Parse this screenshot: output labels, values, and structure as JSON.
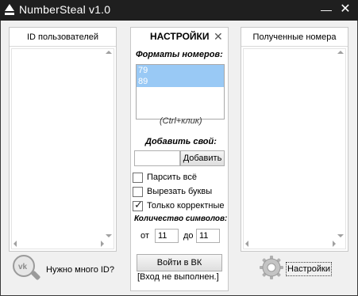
{
  "window": {
    "title": "NumberSteal v1.0",
    "minimize_glyph": "—",
    "close_glyph": "✕"
  },
  "left_panel": {
    "header": "ID пользователей",
    "footer_text": "Нужно много ID?"
  },
  "settings": {
    "title": "НАСТРОЙКИ",
    "close_glyph": "✕",
    "formats_label": "Форматы номеров:",
    "formats": [
      "79",
      "89"
    ],
    "hint": "(Ctrl+клик)",
    "add_label": "Добавить свой:",
    "add_input_value": "",
    "add_button": "Добавить",
    "checkboxes": [
      {
        "label": "Парсить всё",
        "checked": false
      },
      {
        "label": "Вырезать буквы",
        "checked": false
      },
      {
        "label": "Только корректные",
        "checked": true
      }
    ],
    "count_label": "Количество символов:",
    "from_label": "от",
    "from_value": "11",
    "to_label": "до",
    "to_value": "11",
    "login_button": "Войти в ВК",
    "status": "[Вход не выполнен.]"
  },
  "right_panel": {
    "header": "Полученные номера",
    "settings_button": "Настройки"
  },
  "colors": {
    "titlebar": "#1f1f1f",
    "selection": "#99c9f5",
    "background": "#f0f0f0"
  }
}
